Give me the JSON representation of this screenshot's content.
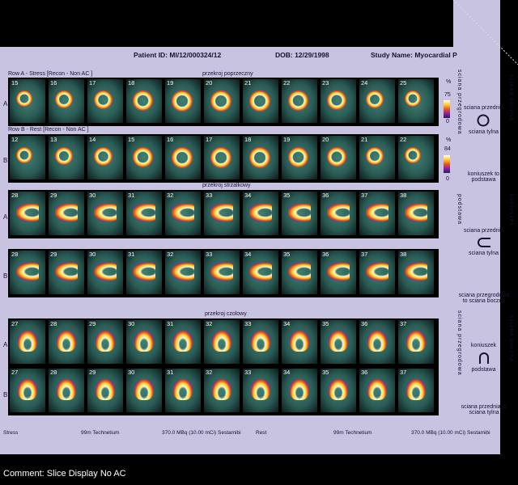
{
  "header": {
    "patient_id": "Patient ID: MI/12/000324/12",
    "dob": "DOB: 12/29/1998",
    "study_name": "Study Name: Myocardial P"
  },
  "section1": {
    "row_a_label": "Row A - Stress [Recon - Non AC ]",
    "row_b_label": "Row B - Rest [Recon - Non AC ]",
    "title": "przekroj poprzeczny",
    "row_a_nums": [
      "15",
      "16",
      "17",
      "18",
      "19",
      "20",
      "21",
      "22",
      "23",
      "24",
      "25"
    ],
    "row_b_nums": [
      "12",
      "13",
      "14",
      "15",
      "16",
      "17",
      "18",
      "19",
      "20",
      "21",
      "22"
    ]
  },
  "section2": {
    "title": "przekroj strzalkowy",
    "row_a_nums": [
      "28",
      "29",
      "30",
      "31",
      "32",
      "33",
      "34",
      "35",
      "36",
      "37",
      "38"
    ],
    "row_b_nums": [
      "28",
      "29",
      "30",
      "31",
      "32",
      "33",
      "34",
      "35",
      "36",
      "37",
      "38"
    ]
  },
  "section3": {
    "title": "przekroj czolowy",
    "row_a_nums": [
      "27",
      "28",
      "29",
      "30",
      "31",
      "32",
      "33",
      "34",
      "35",
      "36",
      "37"
    ],
    "row_b_nums": [
      "27",
      "28",
      "29",
      "30",
      "31",
      "32",
      "33",
      "34",
      "35",
      "36",
      "37"
    ]
  },
  "row_letters": {
    "a": "A",
    "b": "B"
  },
  "colorbars": {
    "unit": "%",
    "a_max": "75",
    "a_min": "0",
    "b_max": "84",
    "b_min": "0"
  },
  "right_panel": {
    "vert_left_top": "sciana przegrodowa",
    "vert_right_top": "sciana boczna",
    "s1_top": "sciana przednia",
    "s1_bottom": "sciana tylna",
    "s1b": "koniuszek to podstawa",
    "vert_left_mid": "podstawa",
    "vert_right_mid": "koniuszek",
    "s2_top": "sciana przednia",
    "s2_bottom": "sciana tylna",
    "s2b": "sciana przegrodowa to sciana boczna",
    "vert_left_bot": "sciana przegrodowa",
    "vert_right_bot": "sciana boczna",
    "s3_top": "koniuszek",
    "s3_bottom": "podstawa",
    "s3b": "sciana przednia to sciana tylna"
  },
  "footer": {
    "stress": "Stress",
    "stress_isotope": "99m Technetium",
    "stress_dose": "370.0 MBq (10.00 mCi) Sestamibi",
    "rest": "Rest",
    "rest_isotope": "99m Technetium",
    "rest_dose": "370.0 MBq (10.00 mCi) Sestamibi"
  },
  "comment": "Comment: Slice Display No AC",
  "colors": {
    "panel_bg": "#c9c3e2",
    "tissue": "#2a5b55",
    "hot": "#ffd34d",
    "ring_outer": "#8b1fa0"
  }
}
